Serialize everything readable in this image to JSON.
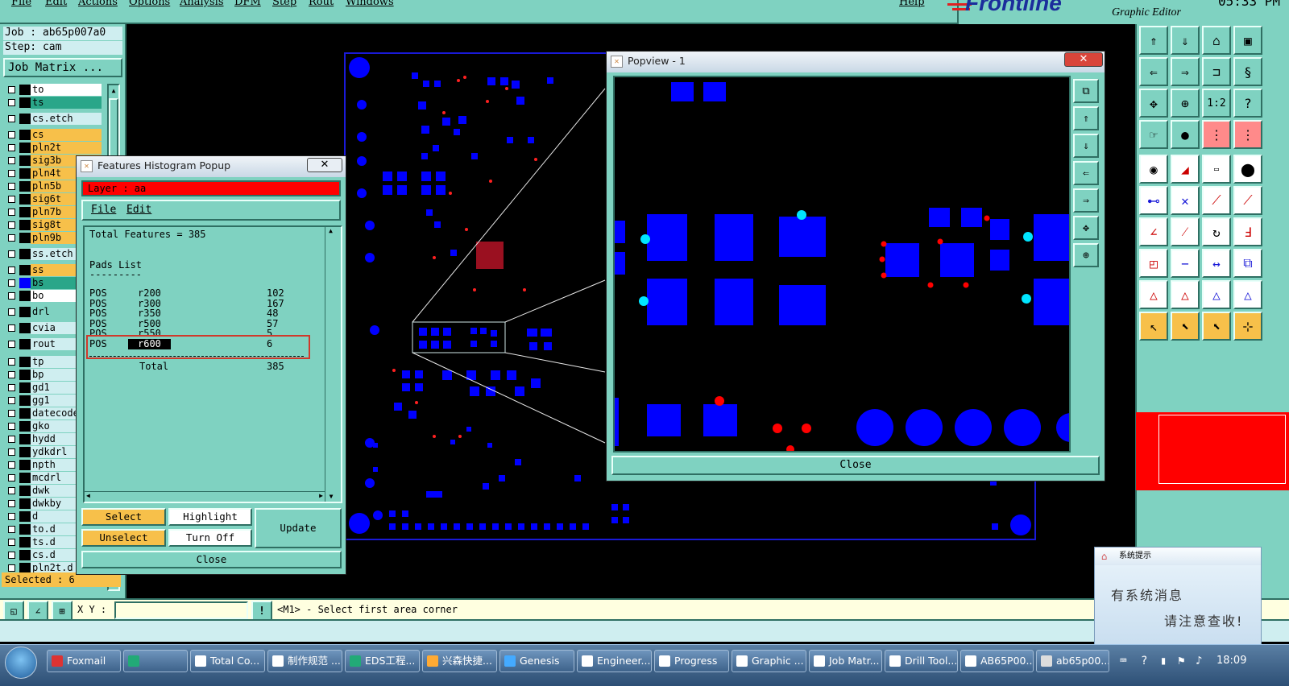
{
  "menu": [
    "File",
    "Edit",
    "Actions",
    "Options",
    "Analysis",
    "DFM",
    "Step",
    "Rout",
    "Windows",
    "Help"
  ],
  "logo": {
    "brand": "Frontline",
    "subtitle": "Graphic Editor",
    "clock": "05:33 PM"
  },
  "job": {
    "job_line": "Job : ab65p007a0",
    "step_line": "Step: cam",
    "matrix_button": "Job Matrix ..."
  },
  "layers": [
    {
      "name": "to",
      "color": "#ffffff"
    },
    {
      "name": "ts",
      "color": "#2aa689"
    },
    {
      "name": "cs.etch",
      "color": "#cfeef0"
    },
    {
      "name": "cs",
      "color": "#f7c04a"
    },
    {
      "name": "pln2t",
      "color": "#f7c04a"
    },
    {
      "name": "sig3b",
      "color": "#f7c04a"
    },
    {
      "name": "pln4t",
      "color": "#f7c04a"
    },
    {
      "name": "pln5b",
      "color": "#f7c04a"
    },
    {
      "name": "sig6t",
      "color": "#f7c04a"
    },
    {
      "name": "pln7b",
      "color": "#f7c04a"
    },
    {
      "name": "sig8t",
      "color": "#f7c04a"
    },
    {
      "name": "pln9b",
      "color": "#f7c04a"
    },
    {
      "name": "ss.etch",
      "color": "#cfeef0"
    },
    {
      "name": "ss",
      "color": "#f7c04a"
    },
    {
      "name": "bs",
      "color": "#2aa689"
    },
    {
      "name": "bo",
      "color": "#ffffff"
    },
    {
      "name": "drl",
      "color": "#7fd2c1"
    },
    {
      "name": "cvia",
      "color": "#cfeef0"
    },
    {
      "name": "rout",
      "color": "#cfeef0"
    },
    {
      "name": "tp",
      "color": "#cfeef0"
    },
    {
      "name": "bp",
      "color": "#cfeef0"
    },
    {
      "name": "gd1",
      "color": "#cfeef0"
    },
    {
      "name": "gg1",
      "color": "#cfeef0"
    },
    {
      "name": "datecode",
      "color": "#cfeef0"
    },
    {
      "name": "gko",
      "color": "#cfeef0"
    },
    {
      "name": "hydd",
      "color": "#cfeef0"
    },
    {
      "name": "ydkdrl",
      "color": "#cfeef0"
    },
    {
      "name": "npth",
      "color": "#cfeef0"
    },
    {
      "name": "mcdrl",
      "color": "#cfeef0"
    },
    {
      "name": "dwk",
      "color": "#cfeef0"
    },
    {
      "name": "dwkby",
      "color": "#cfeef0"
    },
    {
      "name": "d",
      "color": "#cfeef0"
    },
    {
      "name": "to.d",
      "color": "#cfeef0"
    },
    {
      "name": "ts.d",
      "color": "#cfeef0"
    },
    {
      "name": "cs.d",
      "color": "#cfeef0"
    },
    {
      "name": "pln2t.d",
      "color": "#cfeef0"
    }
  ],
  "selected_text": "Selected : 6",
  "histogram": {
    "window_title": "Features Histogram Popup",
    "layer_label": "Layer :  aa",
    "menu": [
      "File",
      "Edit"
    ],
    "total_features": "Total Features = 385",
    "pads_list": "Pads List",
    "rows": [
      {
        "type": "POS",
        "symbol": "r200",
        "count": "102"
      },
      {
        "type": "POS",
        "symbol": "r300",
        "count": "167"
      },
      {
        "type": "POS",
        "symbol": "r350",
        "count": "48"
      },
      {
        "type": "POS",
        "symbol": "r500",
        "count": "57"
      },
      {
        "type": "POS",
        "symbol": "r550",
        "count": "5"
      },
      {
        "type": "POS",
        "symbol": "r600",
        "count": "6"
      }
    ],
    "total_label": "Total",
    "total_value": "385",
    "buttons": {
      "select": "Select",
      "highlight": "Highlight",
      "update": "Update",
      "unselect": "Unselect",
      "turn_off": "Turn Off",
      "close": "Close"
    }
  },
  "popview": {
    "window_title": "Popview - 1",
    "close_label": "Close"
  },
  "command": {
    "xy_label": "X Y :",
    "prompt": "<M1> - Select first area corner"
  },
  "taskbar": [
    "Foxmail",
    "",
    "Total Co...",
    "制作规范 ...",
    "EDS工程...",
    "兴森快捷...",
    "Genesis",
    "Engineer...",
    "Progress",
    "Graphic ...",
    "Job Matr...",
    "Drill Tool...",
    "AB65P00...",
    "ab65p00..."
  ],
  "tray_time": "18:09",
  "notification": {
    "title": "系统提示",
    "line1": "有系统消息",
    "line2": "请注意查收!"
  },
  "colors": {
    "panel": "#7fd2c1",
    "pad": "#0000ff",
    "highlight": "#00e5ff",
    "red_pad": "#ff0000",
    "layer_bar": "#ff0000"
  }
}
